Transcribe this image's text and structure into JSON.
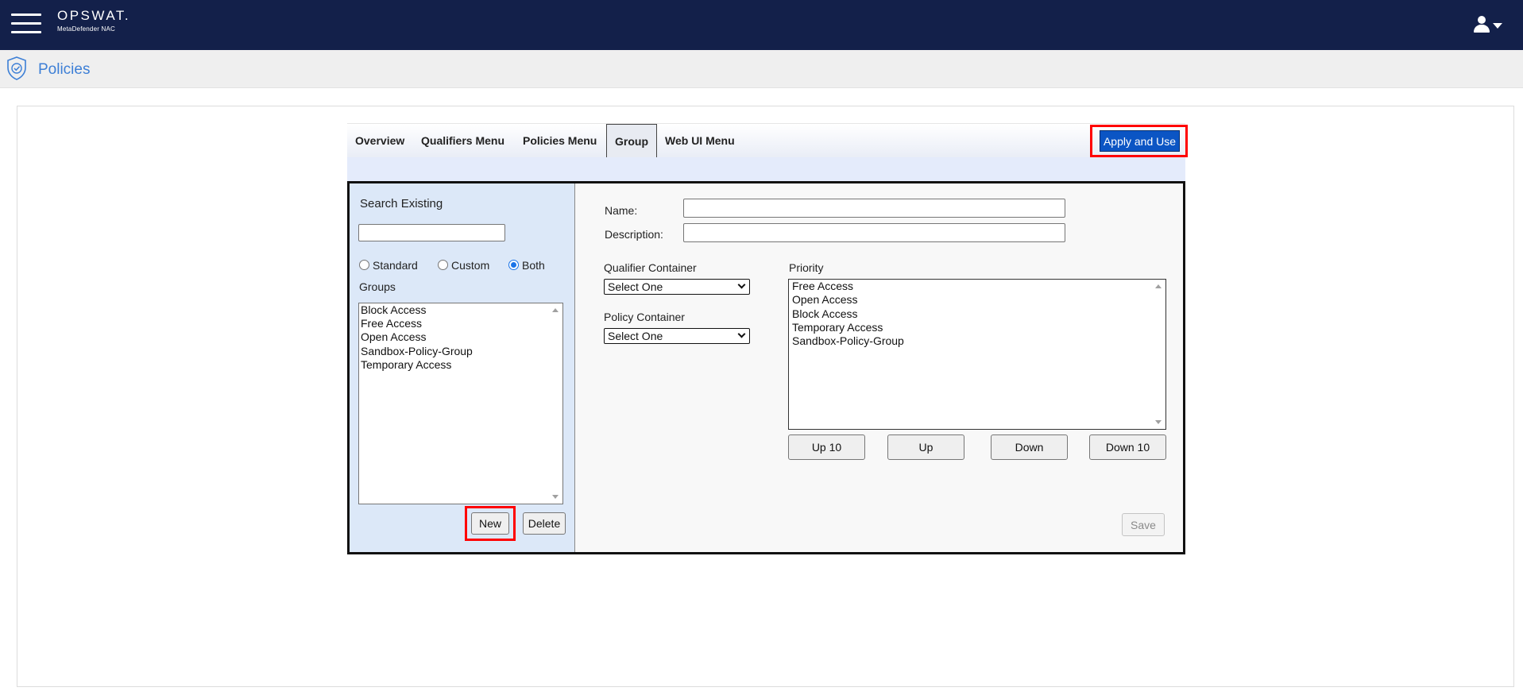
{
  "header": {
    "brand_name": "OPSWAT.",
    "brand_sub": "MetaDefender NAC",
    "menu_icon": "hamburger-icon",
    "user_icon": "user-icon"
  },
  "page": {
    "title": "Policies",
    "title_icon": "shield-check-icon",
    "accent_color": "#3d7fd6"
  },
  "tabs": [
    {
      "label": "Overview",
      "active": false
    },
    {
      "label": "Qualifiers Menu",
      "active": false
    },
    {
      "label": "Policies Menu",
      "active": false
    },
    {
      "label": "Group",
      "active": true
    },
    {
      "label": "Web UI Menu",
      "active": false
    }
  ],
  "apply_button": {
    "label": "Apply and Use",
    "color": "#0b55c4"
  },
  "search": {
    "label": "Search Existing",
    "value": "",
    "filters": [
      {
        "label": "Standard",
        "checked": false
      },
      {
        "label": "Custom",
        "checked": false
      },
      {
        "label": "Both",
        "checked": true
      }
    ],
    "groups_label": "Groups",
    "groups": [
      "Block Access",
      "Free Access",
      "Open Access",
      "Sandbox-Policy-Group",
      "Temporary Access"
    ],
    "new_label": "New",
    "delete_label": "Delete"
  },
  "form": {
    "name_label": "Name:",
    "name_value": "",
    "description_label": "Description:",
    "description_value": "",
    "qualifier_container_label": "Qualifier Container",
    "qualifier_container_value": "Select One",
    "policy_container_label": "Policy Container",
    "policy_container_value": "Select One",
    "priority_label": "Priority",
    "priority_items": [
      "Free Access",
      "Open Access",
      "Block Access",
      "Temporary Access",
      "Sandbox-Policy-Group"
    ],
    "up10_label": "Up 10",
    "up_label": "Up",
    "down_label": "Down",
    "down10_label": "Down 10",
    "save_label": "Save"
  }
}
